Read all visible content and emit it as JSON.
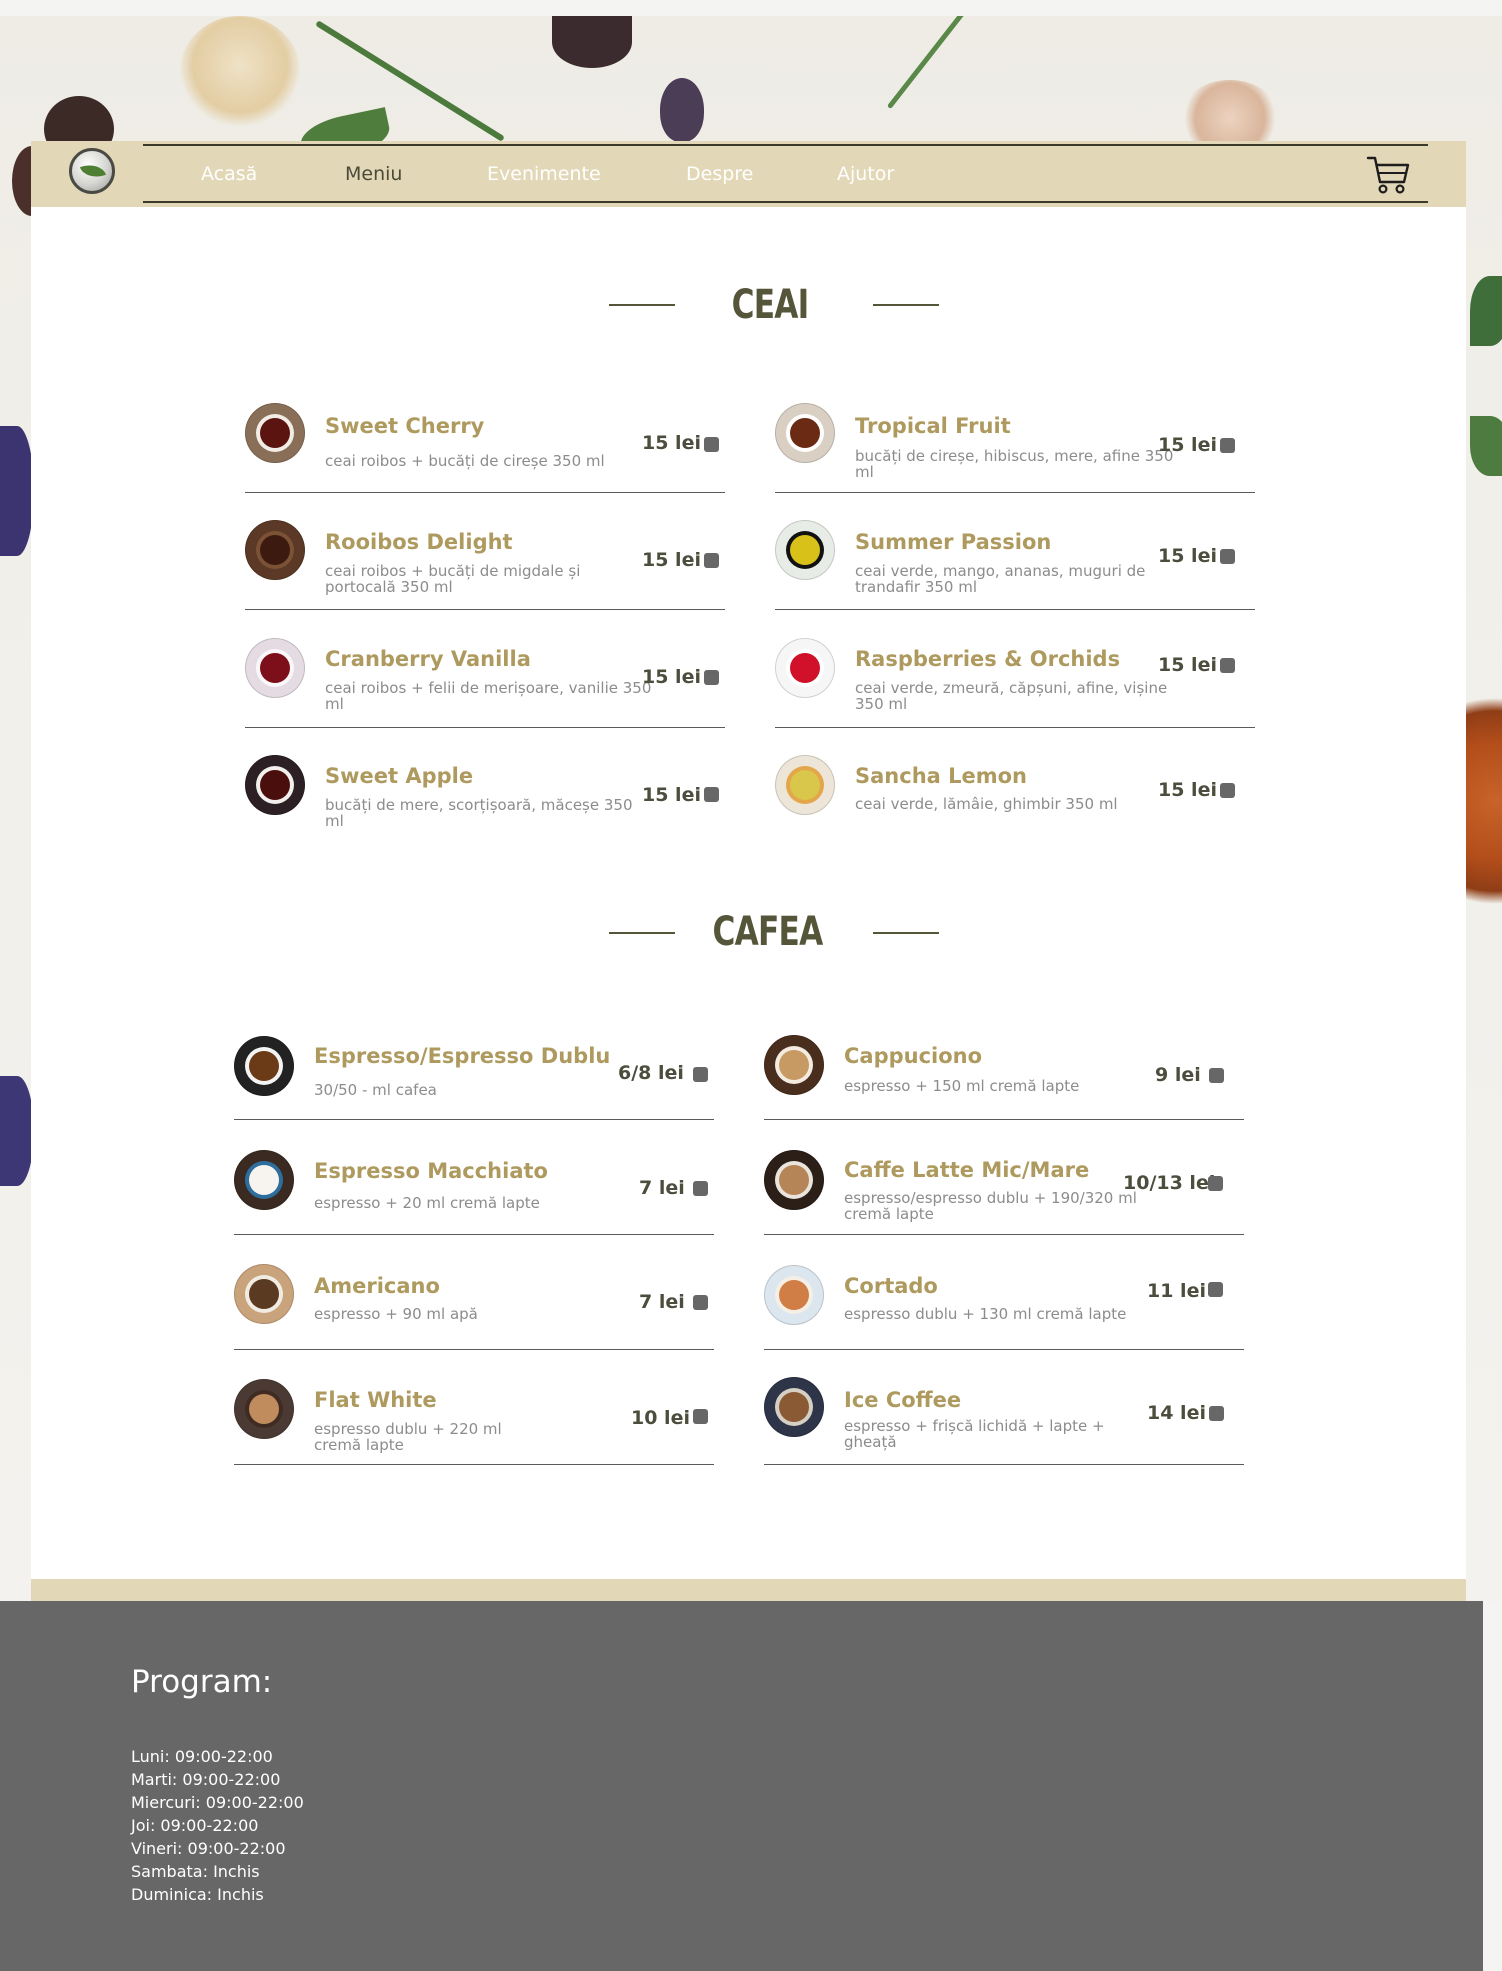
{
  "nav": {
    "items": [
      "Acasă",
      "Meniu",
      "Evenimente",
      "Despre",
      "Ajutor"
    ],
    "active": "Meniu"
  },
  "sections": {
    "tea": {
      "title": "CEAI",
      "items": [
        {
          "name": "Sweet Cherry",
          "desc": "ceai roibos + bucăți de cireșe 350 ml",
          "price": "15 lei"
        },
        {
          "name": "Tropical Fruit",
          "desc": "bucăți de cireșe, hibiscus, mere, afine 350 ml",
          "price": "15 lei"
        },
        {
          "name": "Rooibos Delight",
          "desc": "ceai roibos + bucăți de migdale și portocală 350 ml",
          "price": "15 lei"
        },
        {
          "name": "Summer Passion",
          "desc": "ceai verde, mango, ananas, muguri de trandafir 350 ml",
          "price": "15 lei"
        },
        {
          "name": "Cranberry Vanilla",
          "desc": "ceai roibos + felii de merișoare, vanilie 350 ml",
          "price": "15 lei"
        },
        {
          "name": "Raspberries & Orchids",
          "desc": "ceai verde, zmeură, căpșuni, afine, vișine 350 ml",
          "price": "15 lei"
        },
        {
          "name": "Sweet Apple",
          "desc": "bucăți de mere, scorțișoară, măceșe 350 ml",
          "price": "15 lei"
        },
        {
          "name": "Sancha Lemon",
          "desc": "ceai verde, lămâie, ghimbir 350 ml",
          "price": "15 lei"
        }
      ]
    },
    "coffee": {
      "title": "CAFEA",
      "items": [
        {
          "name": "Espresso/Espresso Dublu",
          "desc": "30/50 - ml cafea",
          "price": "6/8 lei"
        },
        {
          "name": "Cappuciono",
          "desc": "espresso + 150 ml cremă lapte",
          "price": "9 lei"
        },
        {
          "name": "Espresso Macchiato",
          "desc": "espresso + 20 ml cremă lapte",
          "price": "7 lei"
        },
        {
          "name": "Caffe Latte Mic/Mare",
          "desc": "espresso/espresso dublu + 190/320 ml cremă lapte",
          "price": "10/13  lei"
        },
        {
          "name": "Americano",
          "desc": "espresso + 90 ml apă",
          "price": "7 lei"
        },
        {
          "name": "Cortado",
          "desc": "espresso dublu + 130 ml cremă lapte",
          "price": "11 lei"
        },
        {
          "name": "Flat White",
          "desc": "espresso dublu + 220 ml cremă lapte",
          "price": "10 lei"
        },
        {
          "name": "Ice Coffee",
          "desc": "espresso + frișcă lichidă + lapte + gheață",
          "price": "14 lei"
        }
      ]
    }
  },
  "footer": {
    "title": "Program:",
    "hours": [
      "Luni: 09:00-22:00",
      "Marti: 09:00-22:00",
      "Miercuri: 09:00-22:00",
      "Joi: 09:00-22:00",
      "Vineri: 09:00-22:00",
      "Sambata: Inchis",
      "Duminica: Inchis"
    ]
  },
  "colors": {
    "accent": "#ae9a5e",
    "navbar": "#e2d7b6",
    "footer": "#676767",
    "heading": "#55553a"
  },
  "icons": [
    "leaf-logo-icon",
    "cart-icon",
    "add-to-cart-icon"
  ]
}
